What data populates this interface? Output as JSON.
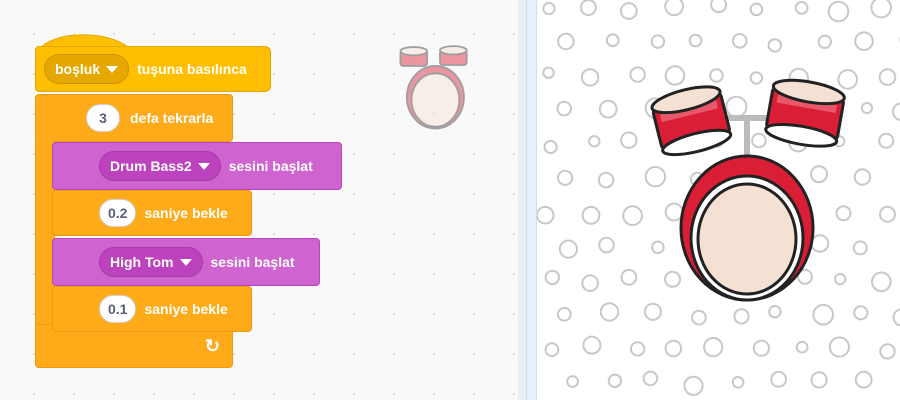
{
  "script": {
    "hat": {
      "key_value": "boşluk",
      "label": "tuşuna basılınca"
    },
    "repeat": {
      "count": "3",
      "label": "defa tekrarla"
    },
    "steps": [
      {
        "sound": "Drum Bass2",
        "label": "sesini başlat"
      },
      {
        "wait": "0.2",
        "label": "saniye bekle"
      },
      {
        "sound": "High Tom",
        "label": "sesini başlat"
      },
      {
        "wait": "0.1",
        "label": "saniye bekle"
      }
    ],
    "loop_arrow": "↻"
  },
  "colors": {
    "events": "#ffbf00",
    "control": "#ffab19",
    "sound": "#cf63cf",
    "drum_red": "#d91e36",
    "drum_head": "#f5e1d3"
  },
  "sprite_ghost": {
    "icon": "drum-icon"
  },
  "stage": {
    "sprite": "drum-kit",
    "backdrop": "polka-dot-bubbles"
  }
}
